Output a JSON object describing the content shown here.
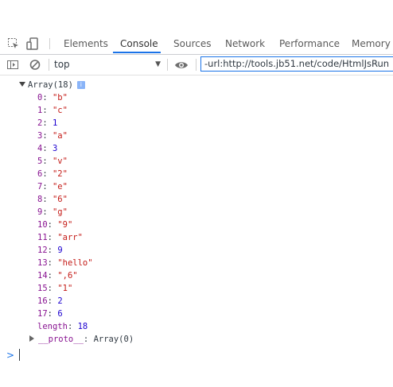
{
  "devtools": {
    "tabs": [
      {
        "label": "Elements"
      },
      {
        "label": "Console"
      },
      {
        "label": "Sources"
      },
      {
        "label": "Network"
      },
      {
        "label": "Performance"
      },
      {
        "label": "Memory"
      }
    ],
    "active_tab": "Console"
  },
  "toolbar": {
    "context": "top",
    "filter_value": "-url:http://tools.jb51.net/code/HtmlJsRun"
  },
  "console": {
    "array_header": "Array(18)",
    "info_badge": "i",
    "items": [
      {
        "key": "0",
        "value": "\"b\"",
        "type": "string"
      },
      {
        "key": "1",
        "value": "\"c\"",
        "type": "string"
      },
      {
        "key": "2",
        "value": "1",
        "type": "number"
      },
      {
        "key": "3",
        "value": "\"a\"",
        "type": "string"
      },
      {
        "key": "4",
        "value": "3",
        "type": "number"
      },
      {
        "key": "5",
        "value": "\"v\"",
        "type": "string"
      },
      {
        "key": "6",
        "value": "\"2\"",
        "type": "string"
      },
      {
        "key": "7",
        "value": "\"e\"",
        "type": "string"
      },
      {
        "key": "8",
        "value": "\"6\"",
        "type": "string"
      },
      {
        "key": "9",
        "value": "\"g\"",
        "type": "string"
      },
      {
        "key": "10",
        "value": "\"9\"",
        "type": "string"
      },
      {
        "key": "11",
        "value": "\"arr\"",
        "type": "string"
      },
      {
        "key": "12",
        "value": "9",
        "type": "number"
      },
      {
        "key": "13",
        "value": "\"hello\"",
        "type": "string"
      },
      {
        "key": "14",
        "value": "\",6\"",
        "type": "string"
      },
      {
        "key": "15",
        "value": "\"1\"",
        "type": "string"
      },
      {
        "key": "16",
        "value": "2",
        "type": "number"
      },
      {
        "key": "17",
        "value": "6",
        "type": "number"
      }
    ],
    "length_key": "length",
    "length_value": "18",
    "proto_key": "__proto__",
    "proto_value": "Array(0)",
    "prompt_symbol": ">"
  },
  "colors": {
    "key": "#881391",
    "string": "#c41a16",
    "number": "#1c00cf",
    "accent": "#1a73e8"
  },
  "icons": [
    "inspect-element-icon",
    "device-toolbar-icon",
    "sidebar-toggle-icon",
    "clear-console-icon",
    "dropdown-arrow-icon",
    "eye-icon",
    "expand-triangle-icon",
    "info-icon",
    "prompt-chevron-icon"
  ]
}
